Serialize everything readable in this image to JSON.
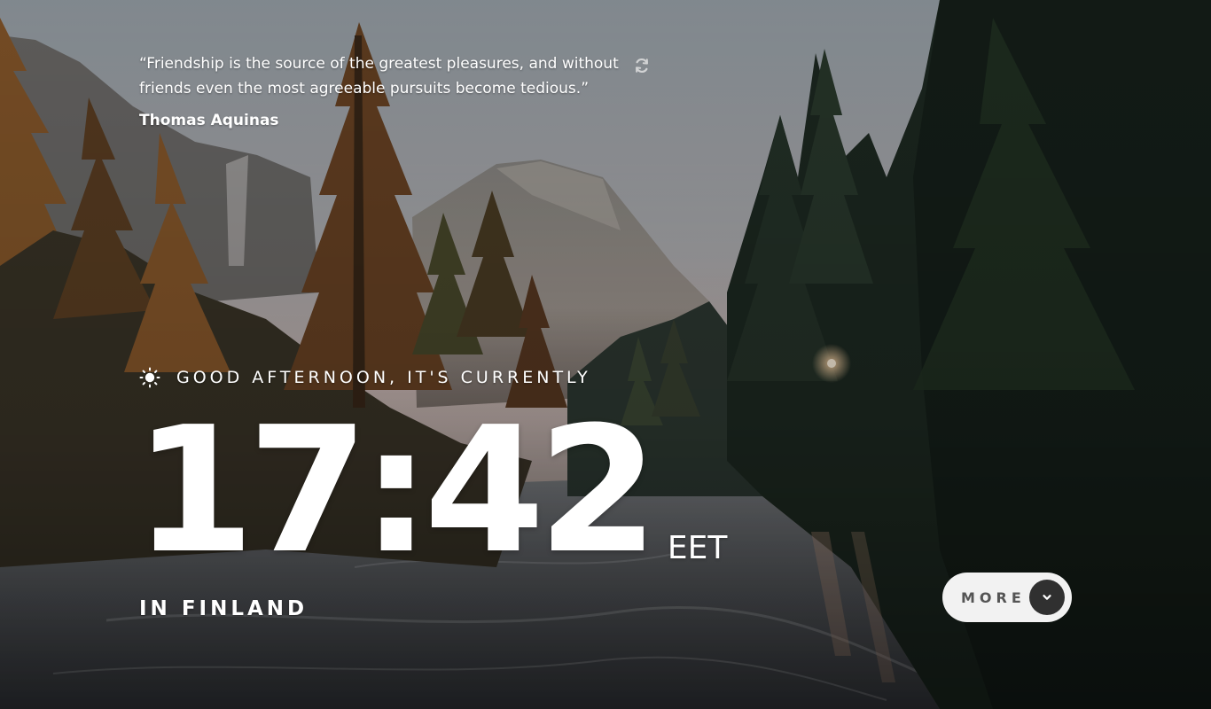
{
  "quote": {
    "text": "“Friendship is the source of the greatest pleasures, and without friends even the most agreeable pursuits become tedious.”",
    "author": "Thomas Aquinas",
    "refresh_icon": "refresh-icon"
  },
  "greeting": {
    "icon": "sun-icon",
    "text": "GOOD AFTERNOON, IT'S CURRENTLY"
  },
  "clock": {
    "time": "17:42",
    "zone": "EET"
  },
  "location": {
    "text": "IN FINLAND"
  },
  "more_button": {
    "label": "MORE",
    "icon": "chevron-down-icon"
  },
  "colors": {
    "text": "#ffffff",
    "button_bg": "#f2f2f2",
    "button_text": "#555555",
    "button_circle": "#303030"
  }
}
